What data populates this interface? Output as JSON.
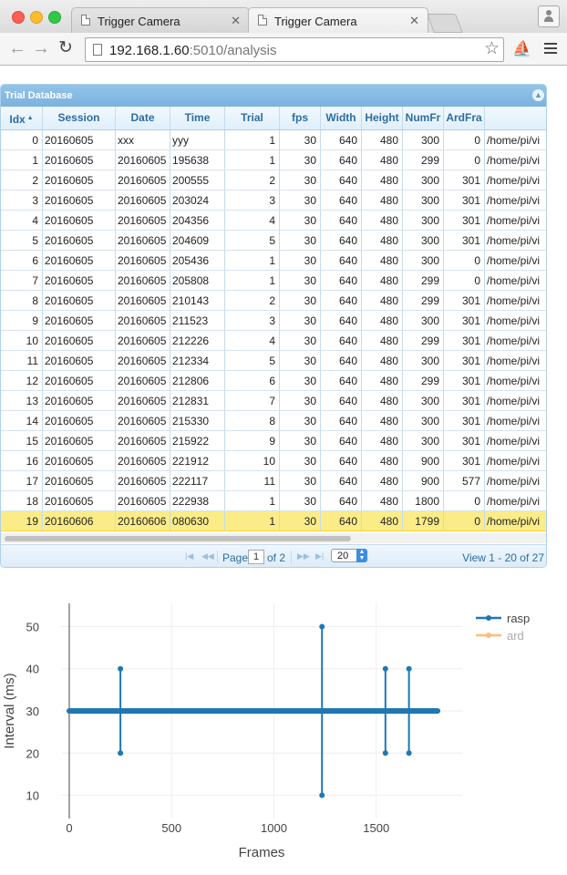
{
  "browser": {
    "tabs": [
      {
        "title": "Trigger Camera",
        "active": false
      },
      {
        "title": "Trigger Camera",
        "active": true
      }
    ],
    "url_host": "192.168.1.60",
    "url_rest": ":5010/analysis"
  },
  "grid": {
    "caption": "Trial Database",
    "collapse_icon": "chevron-up-icon",
    "columns": [
      "Idx",
      "Session",
      "Date",
      "Time",
      "Trial",
      "fps",
      "Width",
      "Height",
      "NumFr",
      "ArdFra",
      ""
    ],
    "sort_column": "Idx",
    "rows": [
      [
        "0",
        "20160605",
        "xxx",
        "yyy",
        "1",
        "30",
        "640",
        "480",
        "300",
        "0",
        "/home/pi/vi"
      ],
      [
        "1",
        "20160605",
        "20160605",
        "195638",
        "1",
        "30",
        "640",
        "480",
        "299",
        "0",
        "/home/pi/vi"
      ],
      [
        "2",
        "20160605",
        "20160605",
        "200555",
        "2",
        "30",
        "640",
        "480",
        "300",
        "301",
        "/home/pi/vi"
      ],
      [
        "3",
        "20160605",
        "20160605",
        "203024",
        "3",
        "30",
        "640",
        "480",
        "300",
        "301",
        "/home/pi/vi"
      ],
      [
        "4",
        "20160605",
        "20160605",
        "204356",
        "4",
        "30",
        "640",
        "480",
        "300",
        "301",
        "/home/pi/vi"
      ],
      [
        "5",
        "20160605",
        "20160605",
        "204609",
        "5",
        "30",
        "640",
        "480",
        "300",
        "301",
        "/home/pi/vi"
      ],
      [
        "6",
        "20160605",
        "20160605",
        "205436",
        "1",
        "30",
        "640",
        "480",
        "300",
        "0",
        "/home/pi/vi"
      ],
      [
        "7",
        "20160605",
        "20160605",
        "205808",
        "1",
        "30",
        "640",
        "480",
        "299",
        "0",
        "/home/pi/vi"
      ],
      [
        "8",
        "20160605",
        "20160605",
        "210143",
        "2",
        "30",
        "640",
        "480",
        "299",
        "301",
        "/home/pi/vi"
      ],
      [
        "9",
        "20160605",
        "20160605",
        "211523",
        "3",
        "30",
        "640",
        "480",
        "300",
        "301",
        "/home/pi/vi"
      ],
      [
        "10",
        "20160605",
        "20160605",
        "212226",
        "4",
        "30",
        "640",
        "480",
        "299",
        "301",
        "/home/pi/vi"
      ],
      [
        "11",
        "20160605",
        "20160605",
        "212334",
        "5",
        "30",
        "640",
        "480",
        "300",
        "301",
        "/home/pi/vi"
      ],
      [
        "12",
        "20160605",
        "20160605",
        "212806",
        "6",
        "30",
        "640",
        "480",
        "299",
        "301",
        "/home/pi/vi"
      ],
      [
        "13",
        "20160605",
        "20160605",
        "212831",
        "7",
        "30",
        "640",
        "480",
        "300",
        "301",
        "/home/pi/vi"
      ],
      [
        "14",
        "20160605",
        "20160605",
        "215330",
        "8",
        "30",
        "640",
        "480",
        "300",
        "301",
        "/home/pi/vi"
      ],
      [
        "15",
        "20160605",
        "20160605",
        "215922",
        "9",
        "30",
        "640",
        "480",
        "300",
        "301",
        "/home/pi/vi"
      ],
      [
        "16",
        "20160605",
        "20160605",
        "221912",
        "10",
        "30",
        "640",
        "480",
        "900",
        "301",
        "/home/pi/vi"
      ],
      [
        "17",
        "20160605",
        "20160605",
        "222117",
        "11",
        "30",
        "640",
        "480",
        "900",
        "577",
        "/home/pi/vi"
      ],
      [
        "18",
        "20160605",
        "20160605",
        "222938",
        "1",
        "30",
        "640",
        "480",
        "1800",
        "0",
        "/home/pi/vi"
      ],
      [
        "19",
        "20160606",
        "20160606",
        "080630",
        "1",
        "30",
        "640",
        "480",
        "1799",
        "0",
        "/home/pi/vi"
      ]
    ],
    "selected_row": 19,
    "pager": {
      "page_label": "Page",
      "page_value": "1",
      "of_label": "of 2",
      "rows_per_page": "20",
      "view_text": "View 1 - 20 of 27"
    }
  },
  "colors": {
    "rasp": "#1f77b4",
    "ard": "#ffbb78",
    "caption_bg": "#7ab2df",
    "selected_row": "#fbec88"
  },
  "chart_data": {
    "type": "line",
    "title": "",
    "xlabel": "Frames",
    "ylabel": "Interval (ms)",
    "xlim": [
      -40,
      1920
    ],
    "ylim": [
      4.5,
      55.5
    ],
    "xticks": [
      0,
      500,
      1000,
      1500
    ],
    "yticks": [
      10,
      20,
      30,
      40,
      50
    ],
    "grid": true,
    "legend_position": "top-right",
    "series": [
      {
        "name": "rasp",
        "color": "#1f77b4",
        "baseline": 30,
        "x_range": [
          0,
          1800
        ],
        "spikes": [
          {
            "x": 250,
            "low": 20,
            "high": 40
          },
          {
            "x": 1235,
            "low": 10,
            "high": 50
          },
          {
            "x": 1545,
            "low": 20,
            "high": 40
          },
          {
            "x": 1660,
            "low": 20,
            "high": 40
          }
        ]
      },
      {
        "name": "ard",
        "color": "#ffbb78",
        "legend_only": true
      }
    ]
  }
}
